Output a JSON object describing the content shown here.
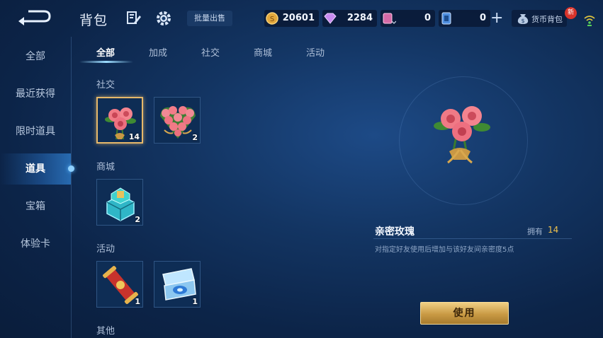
{
  "header": {
    "title": "背包",
    "bulk_sell_label": "批量出售",
    "currencies": [
      {
        "icon": "gold-coin-icon",
        "value": "20601"
      },
      {
        "icon": "diamond-icon",
        "value": "2284"
      },
      {
        "icon": "ticket-icon",
        "value": "0"
      },
      {
        "icon": "voucher-icon",
        "value": "0"
      }
    ],
    "currency_bag_label": "货币背包",
    "new_badge": "新"
  },
  "sidebar": {
    "items": [
      {
        "label": "全部"
      },
      {
        "label": "最近获得"
      },
      {
        "label": "限时道具"
      },
      {
        "label": "道具"
      },
      {
        "label": "宝箱"
      },
      {
        "label": "体验卡"
      }
    ],
    "active_index": 3
  },
  "tabs": [
    {
      "label": "全部"
    },
    {
      "label": "加成"
    },
    {
      "label": "社交"
    },
    {
      "label": "商城"
    },
    {
      "label": "活动"
    }
  ],
  "sections": [
    {
      "label": "社交",
      "items": [
        {
          "name": "rose-item",
          "count": "14",
          "selected": true
        },
        {
          "name": "rose-heart-bouquet-item",
          "count": "2",
          "selected": false
        }
      ]
    },
    {
      "label": "商城",
      "items": [
        {
          "name": "crystal-box-item",
          "count": "2",
          "selected": false
        }
      ]
    },
    {
      "label": "活动",
      "items": [
        {
          "name": "scroll-item",
          "count": "1",
          "selected": false
        },
        {
          "name": "gift-case-item",
          "count": "1",
          "selected": false
        }
      ]
    },
    {
      "label": "其他",
      "items": []
    }
  ],
  "detail": {
    "name": "亲密玫瑰",
    "own_label": "拥有",
    "own_count": "14",
    "description": "对指定好友使用后增加与该好友间亲密度5点",
    "use_label": "使用"
  },
  "colors": {
    "accent_gold": "#f0c24c",
    "selected_border": "#e6b86a",
    "active_tab_glow": "#9cdcff",
    "new_badge": "#d8342b"
  }
}
